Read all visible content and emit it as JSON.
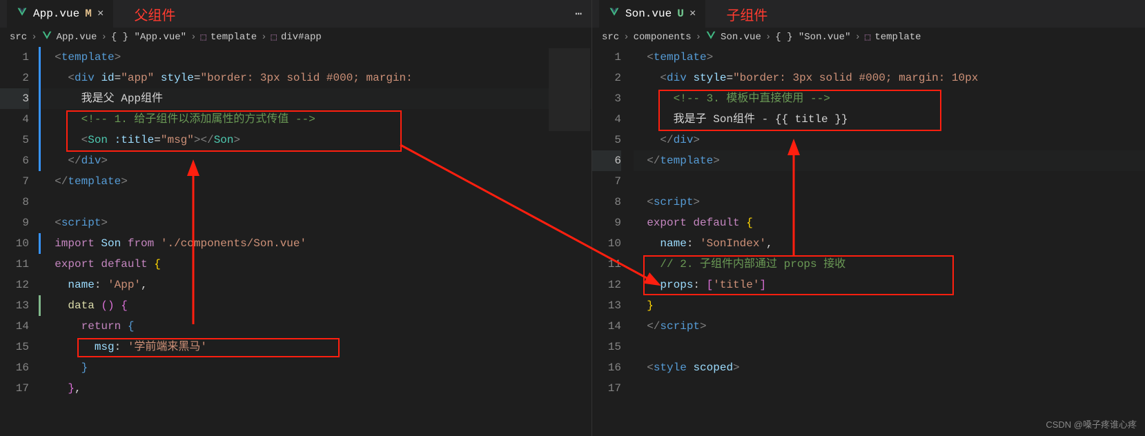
{
  "left": {
    "tab": {
      "filename": "App.vue",
      "badge": "M"
    },
    "annotation": "父组件",
    "breadcrumb": [
      "src",
      "App.vue",
      "{ } \"App.vue\"",
      "template",
      "div#app"
    ],
    "lines": [
      1,
      2,
      3,
      4,
      5,
      6,
      7,
      8,
      9,
      10,
      11,
      12,
      13,
      14,
      15,
      16,
      17
    ],
    "code": {
      "l1": "<template>",
      "l2_text": " id=\"app\" style=\"border: 3px solid #000; margin: ",
      "l3": "我是父 App组件",
      "l4": "<!-- 1. 给子组件以添加属性的方式传值 -->",
      "l5_tag": "Son",
      "l5_attr": ":title",
      "l5_val": "\"msg\"",
      "l6": "</div>",
      "l7": "</template>",
      "l9": "<script>",
      "l10_import": "import",
      "l10_son": "Son",
      "l10_from": "from",
      "l10_path": "'./components/Son.vue'",
      "l11": "export default",
      "l12_name": "name:",
      "l12_val": "'App'",
      "l13": "data",
      "l14": "return",
      "l15_key": "msg:",
      "l15_val": "'学前端来黑马'"
    }
  },
  "right": {
    "tab": {
      "filename": "Son.vue",
      "badge": "U"
    },
    "annotation": "子组件",
    "breadcrumb": [
      "src",
      "components",
      "Son.vue",
      "{ } \"Son.vue\"",
      "template"
    ],
    "lines": [
      1,
      2,
      3,
      4,
      5,
      6,
      7,
      8,
      9,
      10,
      11,
      12,
      13,
      14,
      15,
      16,
      17
    ],
    "code": {
      "l1": "<template>",
      "l2": " style=\"border: 3px solid #000; margin: 10px",
      "l3": "<!-- 3. 模板中直接使用 -->",
      "l4_text": "我是子 Son组件 - ",
      "l4_expr": "{{ title }}",
      "l5": "</div>",
      "l6": "</template>",
      "l8": "<script>",
      "l9": "export default",
      "l10_name": "name:",
      "l10_val": "'SonIndex'",
      "l11": "// 2. 子组件内部通过 props 接收",
      "l12_key": "props:",
      "l12_val": "'title'",
      "l14": "</script>",
      "l16": "<style scoped>"
    }
  },
  "watermark": "CSDN @嗓子疼谁心疼"
}
